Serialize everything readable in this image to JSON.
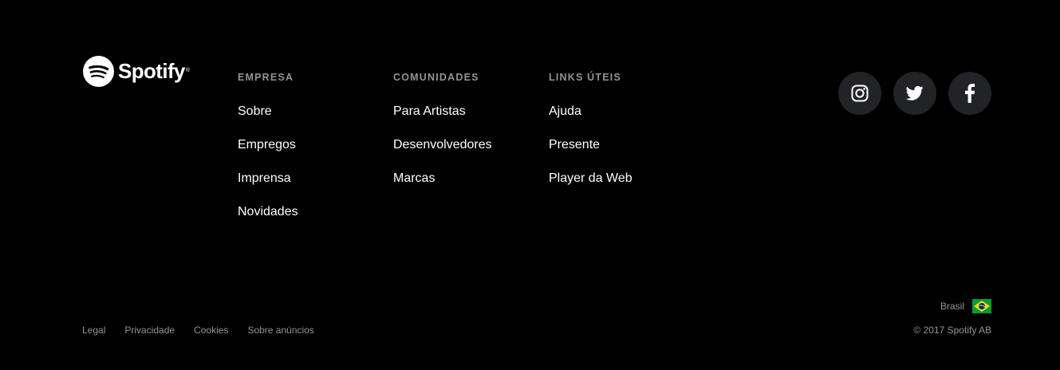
{
  "brand": {
    "name": "Spotify",
    "registered_mark": "®",
    "logo_icon": "spotify-logo-icon",
    "logo_color": "#ffffff"
  },
  "columns": [
    {
      "heading": "EMPRESA",
      "links": [
        "Sobre",
        "Empregos",
        "Imprensa",
        "Novidades"
      ]
    },
    {
      "heading": "COMUNIDADES",
      "links": [
        "Para Artistas",
        "Desenvolvedores",
        "Marcas"
      ]
    },
    {
      "heading": "LINKS ÚTEIS",
      "links": [
        "Ajuda",
        "Presente",
        "Player da Web"
      ]
    }
  ],
  "social": [
    {
      "icon": "instagram-icon"
    },
    {
      "icon": "twitter-icon"
    },
    {
      "icon": "facebook-icon"
    }
  ],
  "country": {
    "label": "Brasil",
    "flag_icon": "brazil-flag-icon"
  },
  "legal_links": [
    "Legal",
    "Privacidade",
    "Cookies",
    "Sobre anúncios"
  ],
  "copyright": "© 2017 Spotify AB",
  "colors": {
    "background": "#000000",
    "heading": "#919496",
    "link": "#ffffff",
    "muted": "#919496",
    "social_bg": "#222326"
  }
}
